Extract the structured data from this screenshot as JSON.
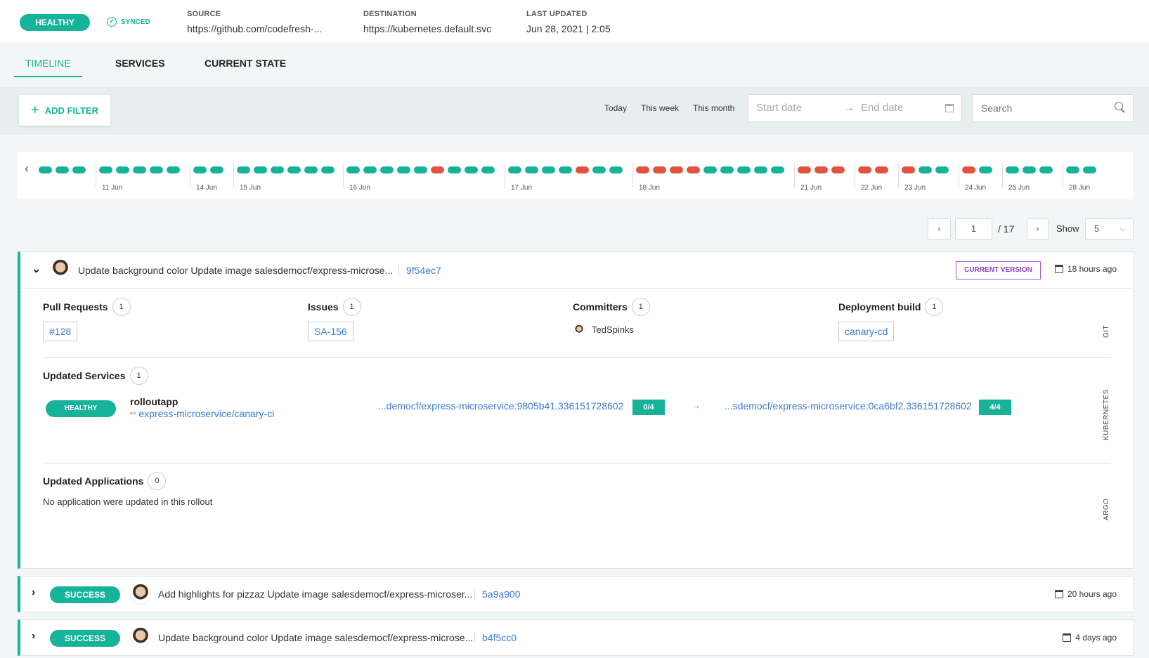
{
  "header": {
    "health": "HEALTHY",
    "sync": "SYNCED",
    "source_label": "SOURCE",
    "source_value": "https://github.com/codefresh-...",
    "destination_label": "DESTINATION",
    "destination_value": "https://kubernetes.default.svc",
    "updated_label": "LAST UPDATED",
    "updated_value": "Jun 28, 2021 | 2:05"
  },
  "tabs": [
    "TIMELINE",
    "SERVICES",
    "CURRENT STATE"
  ],
  "filters": {
    "add_filter": "ADD FILTER",
    "quick": [
      "Today",
      "This week",
      "This month"
    ],
    "start_placeholder": "Start date",
    "end_placeholder": "End date",
    "search_placeholder": "Search"
  },
  "timeline": {
    "labels": [
      "11 Jun",
      "14 Jun",
      "15 Jun",
      "16 Jun",
      "17 Jun",
      "18 Jun",
      "21 Jun",
      "22 Jun",
      "23 Jun",
      "24 Jun",
      "25 Jun",
      "28 Jun"
    ],
    "groups": [
      [
        "ok",
        "ok",
        "ok"
      ],
      [
        "ok",
        "ok",
        "ok",
        "ok",
        "ok"
      ],
      [
        "ok",
        "ok"
      ],
      [
        "ok",
        "ok",
        "ok",
        "ok",
        "ok",
        "ok"
      ],
      [
        "ok",
        "ok",
        "ok",
        "ok",
        "ok",
        "err",
        "ok",
        "ok",
        "ok"
      ],
      [
        "ok",
        "ok",
        "ok",
        "ok",
        "err",
        "ok",
        "ok"
      ],
      [
        "err",
        "err",
        "err",
        "err",
        "ok",
        "ok",
        "ok",
        "ok",
        "ok"
      ],
      [
        "err",
        "err",
        "err"
      ],
      [
        "err",
        "err"
      ],
      [
        "err",
        "ok",
        "ok"
      ],
      [
        "err",
        "ok"
      ],
      [
        "ok",
        "ok",
        "ok"
      ],
      [
        "ok",
        "ok"
      ]
    ]
  },
  "pagination": {
    "page": "1",
    "total": "/ 17",
    "show_label": "Show",
    "show_value": "5"
  },
  "rollouts": [
    {
      "message": "Update background color Update image salesdemocf/express-microse...",
      "sha": "9f54ec7",
      "badge": "CURRENT VERSION",
      "time": "18 hours ago",
      "pull_requests": {
        "title": "Pull Requests",
        "count": "1",
        "item": "#128"
      },
      "issues": {
        "title": "Issues",
        "count": "1",
        "item": "SA-156"
      },
      "committers": {
        "title": "Committers",
        "count": "1",
        "item": "TedSpinks"
      },
      "build": {
        "title": "Deployment build",
        "count": "1",
        "item": "canary-cd"
      },
      "git_label": "GIT",
      "services": {
        "title": "Updated Services",
        "count": "1",
        "status": "HEALTHY",
        "name": "rolloutapp",
        "repo": "express-microservice/canary-ci",
        "from_image": "...democf/express-microservice:9805b41.336151728602",
        "from_ratio": "0/4",
        "arrow": "→",
        "to_image": "...sdemocf/express-microservice:0ca6bf2.336151728602",
        "to_ratio": "4/4",
        "k8s_label": "KUBERNETES"
      },
      "applications": {
        "title": "Updated Applications",
        "count": "0",
        "empty": "No application were updated in this rollout",
        "argo_label": "ARGO"
      }
    },
    {
      "status": "SUCCESS",
      "message": "Add highlights for pizzaz Update image salesdemocf/express-microser...",
      "sha": "5a9a900",
      "time": "20 hours ago"
    },
    {
      "status": "SUCCESS",
      "message": "Update background color Update image salesdemocf/express-microse...",
      "sha": "b4f5cc0",
      "time": "4 days ago"
    }
  ],
  "colors": {
    "accent": "#16b39a",
    "error": "#e1533f",
    "link": "#3a7bd5",
    "current_version": "#8a3fc4"
  }
}
